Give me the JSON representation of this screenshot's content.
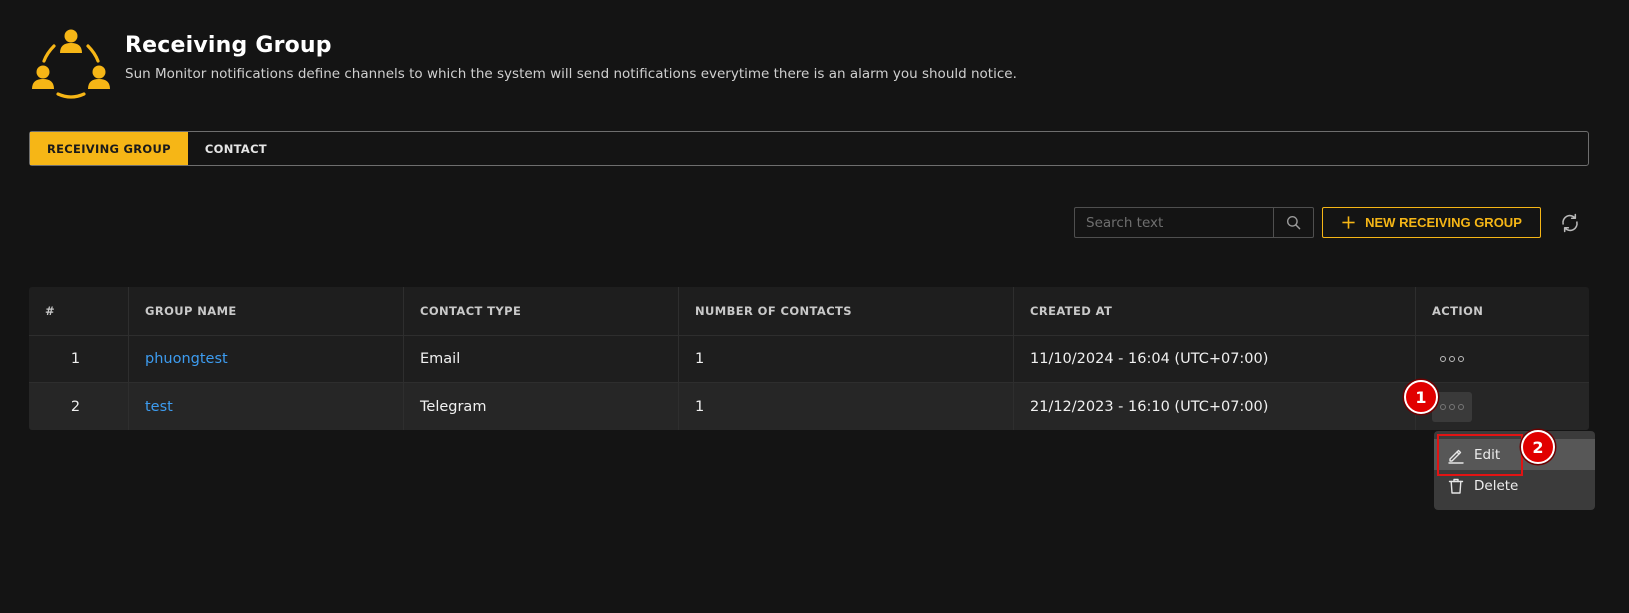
{
  "header": {
    "title": "Receiving Group",
    "subtitle": "Sun Monitor notifications define channels to which the system will send notifications everytime there is an alarm you should notice.",
    "logo_icon": "people-group-icon"
  },
  "tabs": [
    {
      "label": "RECEIVING GROUP",
      "active": true
    },
    {
      "label": "CONTACT",
      "active": false
    }
  ],
  "toolbar": {
    "search_placeholder": "Search text",
    "search_value": "",
    "new_button_label": "NEW RECEIVING GROUP",
    "refresh_icon": "refresh-icon"
  },
  "table": {
    "columns": [
      "#",
      "GROUP NAME",
      "CONTACT TYPE",
      "NUMBER OF CONTACTS",
      "CREATED AT",
      "ACTION"
    ],
    "rows": [
      {
        "index": "1",
        "group_name": "phuongtest",
        "contact_type": "Email",
        "num_contacts": "1",
        "created_at": "11/10/2024 - 16:04 (UTC+07:00)"
      },
      {
        "index": "2",
        "group_name": "test",
        "contact_type": "Telegram",
        "num_contacts": "1",
        "created_at": "21/12/2023 - 16:10 (UTC+07:00)"
      }
    ]
  },
  "action_menu": {
    "items": [
      {
        "label": "Edit",
        "icon": "pencil-icon"
      },
      {
        "label": "Delete",
        "icon": "trash-icon"
      }
    ]
  },
  "annotations": {
    "step1": "1",
    "step2": "2"
  },
  "colors": {
    "accent": "#f6b616",
    "link": "#3d9cf0",
    "background": "#141414",
    "marker": "#e10000"
  }
}
